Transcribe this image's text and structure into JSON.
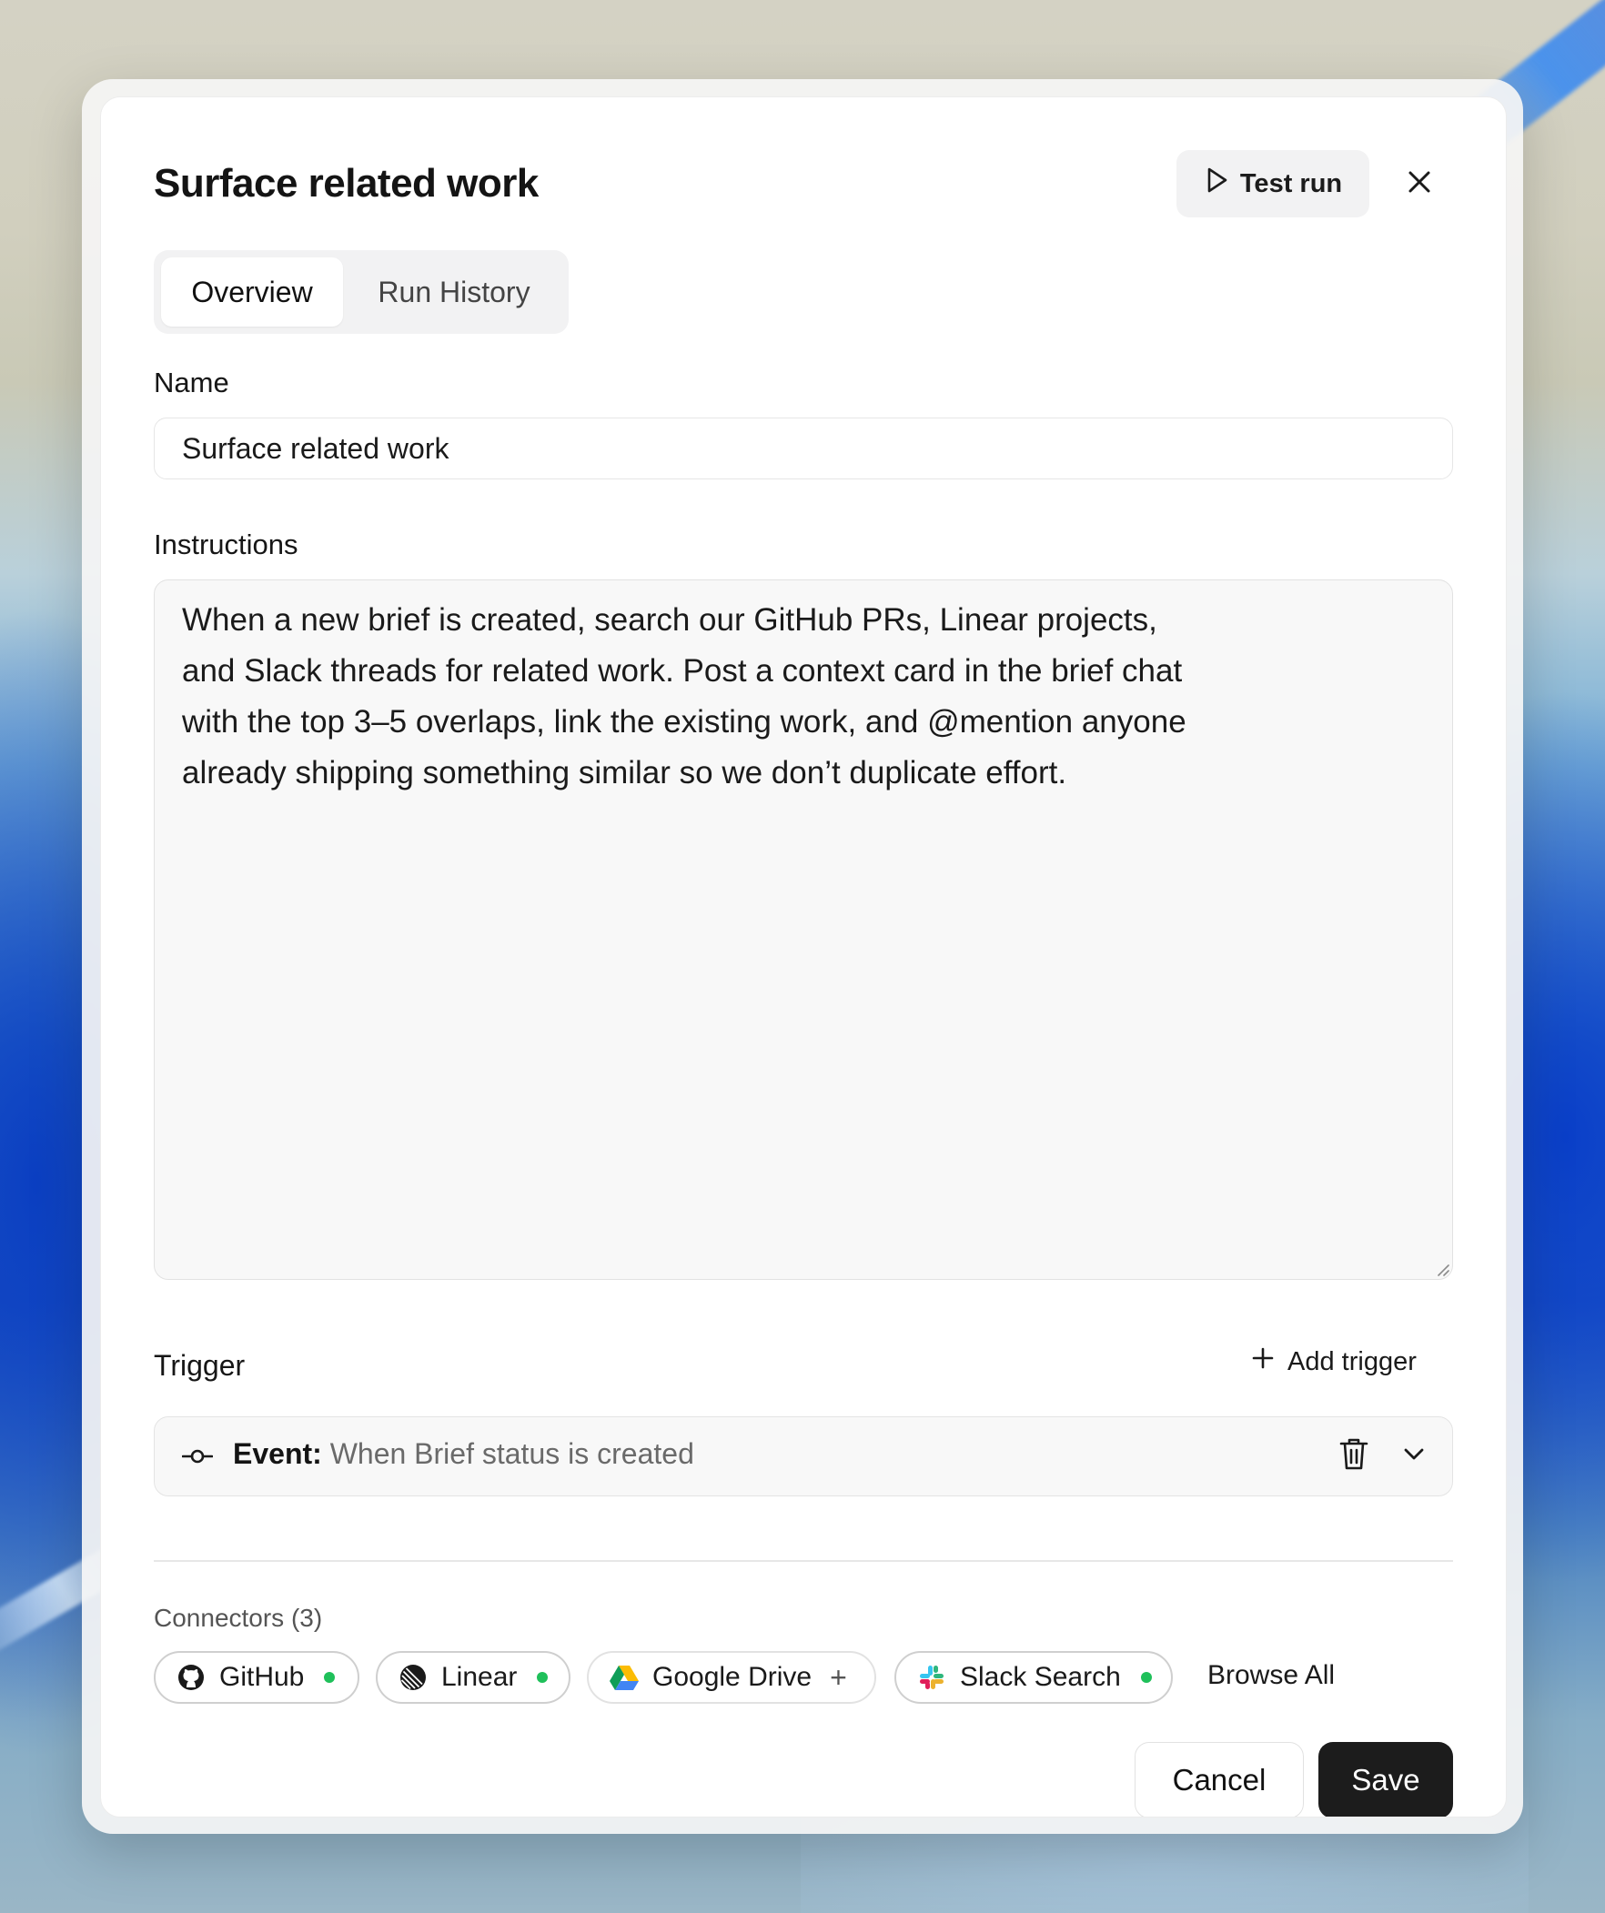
{
  "dialog": {
    "title": "Surface related work",
    "test_run_label": "Test run"
  },
  "tabs": [
    {
      "label": "Overview",
      "active": true
    },
    {
      "label": "Run History",
      "active": false
    }
  ],
  "name_field": {
    "label": "Name",
    "value": "Surface related work"
  },
  "instructions": {
    "label": "Instructions",
    "value": "When a new brief is created, search our GitHub PRs, Linear projects,\nand Slack threads for related work. Post a context card in the brief chat\nwith the top 3–5 overlaps, link the existing work, and @mention anyone\nalready shipping something similar so we don’t duplicate effort."
  },
  "trigger": {
    "label": "Trigger",
    "add_label": "Add trigger",
    "event_prefix": "Event:",
    "event_text": "When Brief status is created"
  },
  "connectors": {
    "label": "Connectors (3)",
    "items": [
      {
        "name": "GitHub",
        "icon": "github-icon",
        "status": "connected"
      },
      {
        "name": "Linear",
        "icon": "linear-icon",
        "status": "connected"
      },
      {
        "name": "Google Drive",
        "icon": "google-drive-icon",
        "status": "add"
      },
      {
        "name": "Slack Search",
        "icon": "slack-icon",
        "status": "connected"
      }
    ],
    "browse_all": "Browse All"
  },
  "footer": {
    "cancel_label": "Cancel",
    "save_label": "Save"
  },
  "colors": {
    "connected_dot": "#1fc05a",
    "save_bg": "#1c1c1c"
  }
}
